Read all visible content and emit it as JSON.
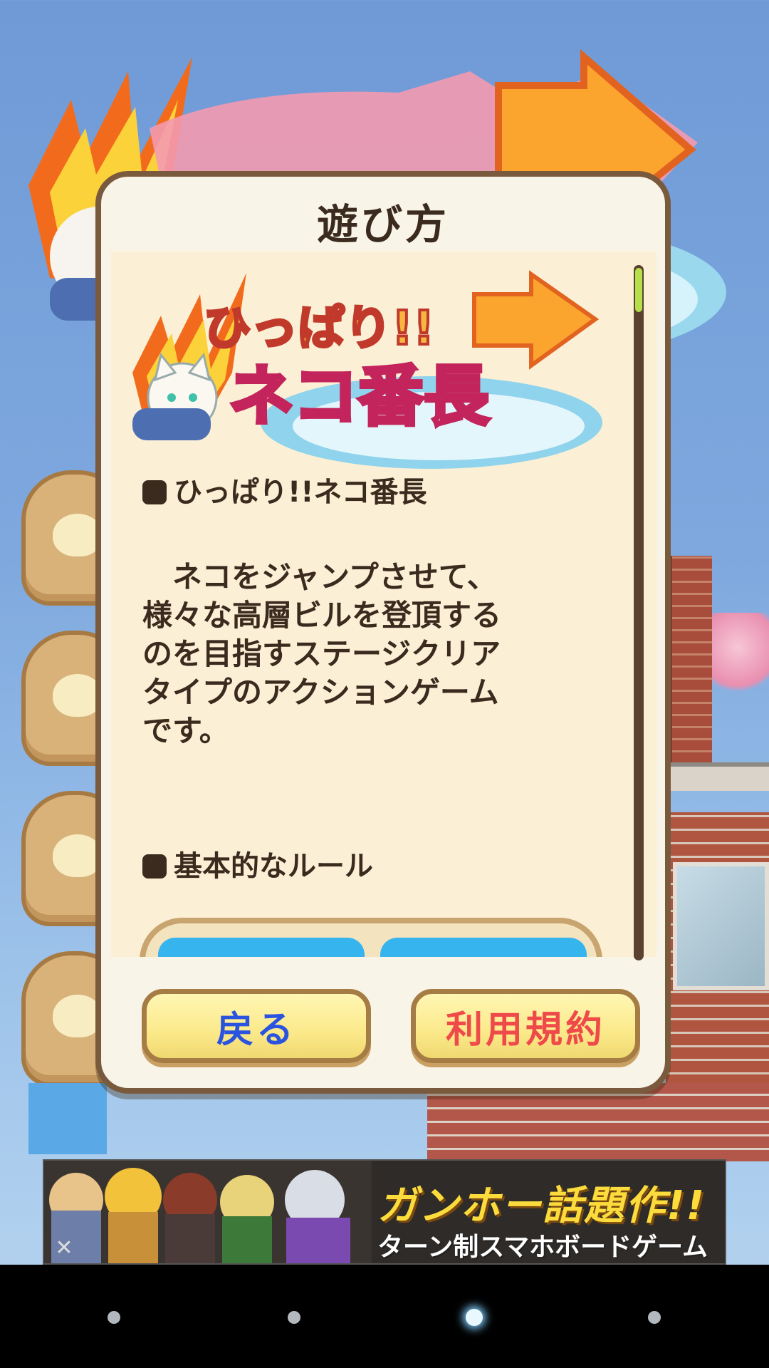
{
  "dialog": {
    "title": "遊び方",
    "logo": {
      "line1": "ひっぱり!!",
      "line2": "ネコ番長"
    },
    "sections": [
      {
        "heading": "ひっぱり!!ネコ番長",
        "body": "　ネコをジャンプさせて、\n様々な高層ビルを登頂する\nのを目指すステージクリア\nタイプのアクションゲーム\nです。"
      },
      {
        "heading": "基本的なルール"
      }
    ],
    "buttons": {
      "back": "戻る",
      "terms": "利用規約"
    }
  },
  "ad": {
    "headline": "ガンホー話題作!!",
    "subline": "ターン制スマホボードゲーム",
    "close_icon": "close-icon"
  },
  "pager": {
    "count": 4,
    "active_index": 2
  },
  "colors": {
    "back_button_text": "#2a54e0",
    "terms_button_text": "#ef4a4a",
    "scroll_thumb": "#b6e04a"
  }
}
